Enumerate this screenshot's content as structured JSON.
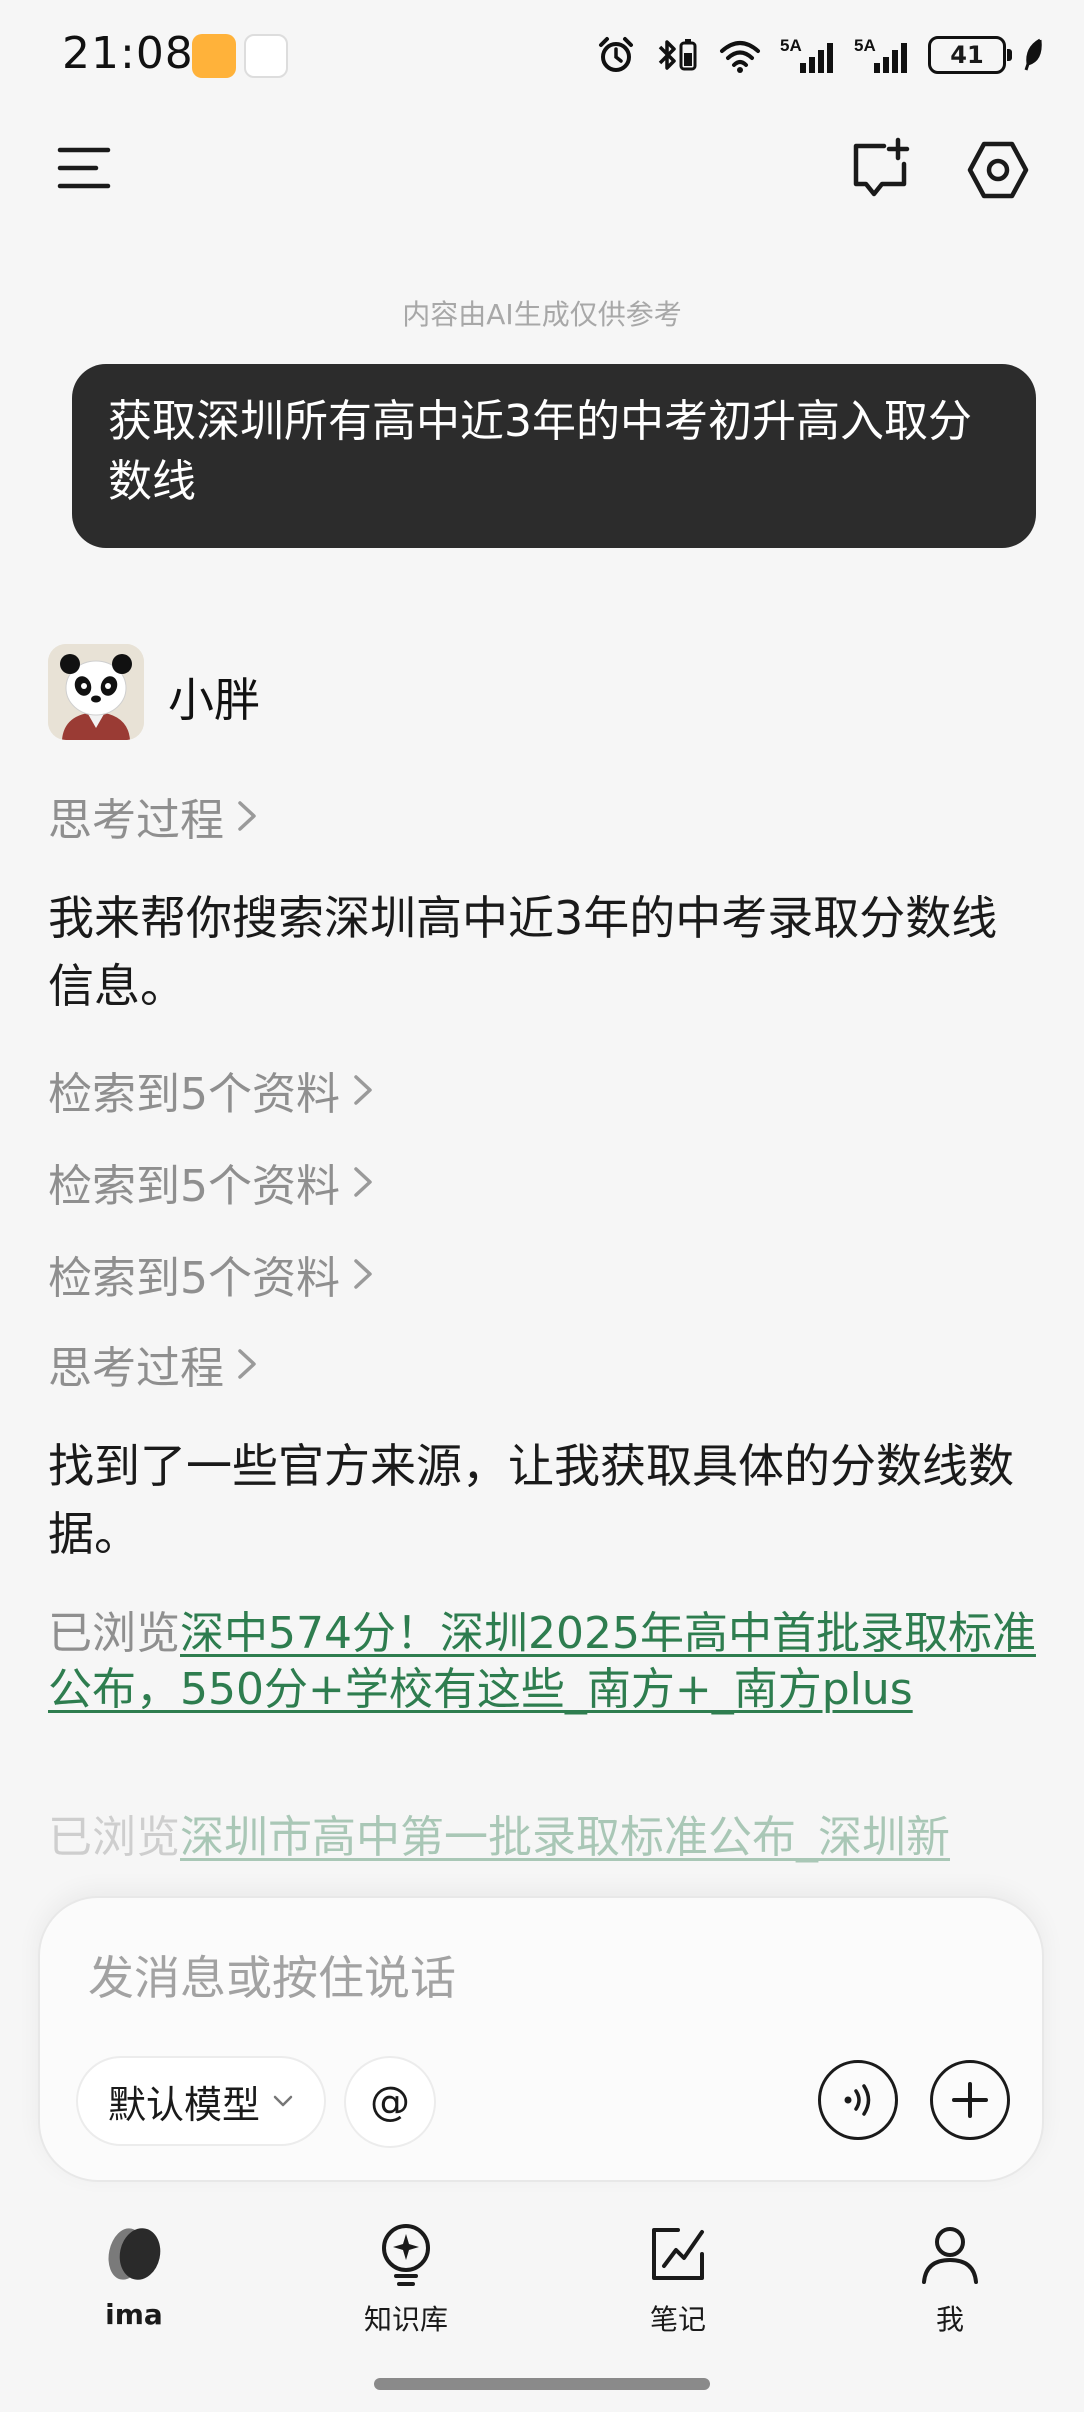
{
  "status_bar": {
    "time": "21:08",
    "battery": "41",
    "signal_1": "5A",
    "signal_2": "5A"
  },
  "conversation": {
    "ai_notice": "内容由AI生成仅供参考",
    "user_message": "获取深圳所有高中近3年的中考初升高入取分数线",
    "bot_name": "小胖",
    "thinking_1": "思考过程",
    "answer_1": "我来帮你搜索深圳高中近3年的中考录取分数线信息。",
    "search_1": "检索到5个资料",
    "search_2": "检索到5个资料",
    "search_3": "检索到5个资料",
    "thinking_2": "思考过程",
    "answer_2": "找到了一些官方来源，让我获取具体的分数线数据。",
    "browsed_prefix_1": "已浏览",
    "browsed_link_1": "深中574分！深圳2025年高中首批录取标准公布，550分+学校有这些_南方+_南方plus",
    "browsed_prefix_2": "已浏览",
    "browsed_link_2": "深圳市高中第一批录取标准公布_深圳新"
  },
  "composer": {
    "placeholder": "发消息或按住说话",
    "model_label": "默认模型",
    "mention_label": "@"
  },
  "bottom_nav": {
    "items": [
      {
        "label": "ima"
      },
      {
        "label": "知识库"
      },
      {
        "label": "笔记"
      },
      {
        "label": "我"
      }
    ]
  },
  "colors": {
    "link_green": "#2e7d4f",
    "bubble_dark": "#2c2c2c",
    "background": "#f6f6f6"
  }
}
